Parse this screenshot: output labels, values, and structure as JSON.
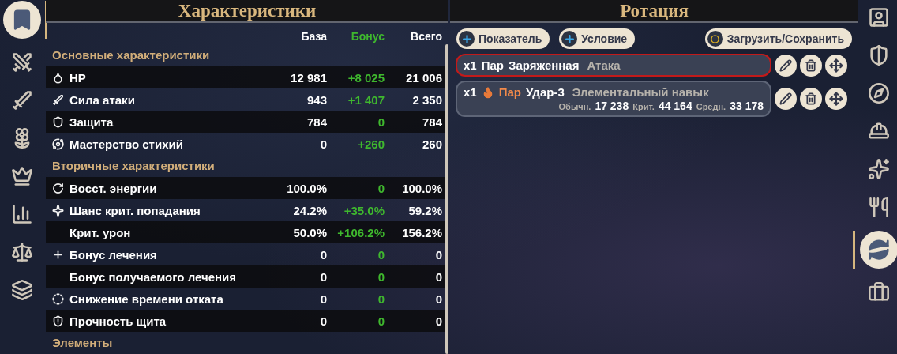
{
  "left_sidebar": [
    {
      "kind": "banner",
      "selected": true
    },
    {
      "kind": "swords",
      "selected": false
    },
    {
      "kind": "sword",
      "selected": false
    },
    {
      "kind": "flower",
      "selected": false
    },
    {
      "kind": "crown",
      "selected": false
    },
    {
      "kind": "chart",
      "selected": false
    },
    {
      "kind": "scales",
      "selected": false
    },
    {
      "kind": "cards",
      "selected": false
    }
  ],
  "stats": {
    "title": "Характеристики",
    "columns": [
      "База",
      "Бонус",
      "Всего"
    ],
    "sections": [
      {
        "title": "Основные характеристики",
        "rows": [
          {
            "kind": "hp",
            "label": "HP",
            "base": "12 981",
            "bonus": "+8 025",
            "total": "21 006"
          },
          {
            "kind": "attack",
            "label": "Сила атаки",
            "base": "943",
            "bonus": "+1 407",
            "total": "2 350"
          },
          {
            "kind": "defense",
            "label": "Защита",
            "base": "784",
            "bonus": "0",
            "total": "784"
          },
          {
            "kind": "mastery",
            "label": "Мастерство стихий",
            "base": "0",
            "bonus": "+260",
            "total": "260"
          }
        ]
      },
      {
        "title": "Вторичные характеристики",
        "rows": [
          {
            "kind": "energy",
            "label": "Восст. энергии",
            "base": "100.0%",
            "bonus": "0",
            "total": "100.0%"
          },
          {
            "kind": "crit",
            "label": "Шанс крит. попадания",
            "base": "24.2%",
            "bonus": "+35.0%",
            "total": "59.2%"
          },
          {
            "kind": "plain",
            "label": "Крит. урон",
            "base": "50.0%",
            "bonus": "+106.2%",
            "total": "156.2%"
          },
          {
            "kind": "heal",
            "label": "Бонус лечения",
            "base": "0",
            "bonus": "0",
            "total": "0"
          },
          {
            "kind": "plain",
            "label": "Бонус получаемого лечения",
            "base": "0",
            "bonus": "0",
            "total": "0"
          },
          {
            "kind": "cooldown",
            "label": "Снижение времени отката",
            "base": "0",
            "bonus": "0",
            "total": "0"
          },
          {
            "kind": "shield",
            "label": "Прочность щита",
            "base": "0",
            "bonus": "0",
            "total": "0"
          }
        ]
      },
      {
        "title": "Элементы"
      }
    ]
  },
  "rotation": {
    "title": "Ротация",
    "buttons": [
      {
        "kind": "add",
        "label": "Показатель"
      },
      {
        "kind": "add",
        "label": "Условие"
      },
      {
        "kind": "load",
        "label": "Загрузить/Сохранить"
      }
    ],
    "entries": [
      {
        "count": "x1",
        "selected": true,
        "element": false,
        "reaction": "Пар",
        "reaction_active": false,
        "name": "Заряженная",
        "type": "Атака"
      },
      {
        "count": "x1",
        "selected": false,
        "element": true,
        "reaction": "Пар",
        "reaction_active": true,
        "name": "Удар-3",
        "type": "Элементальный навык",
        "damage": [
          {
            "label": "Обычн.",
            "value": "17 238"
          },
          {
            "label": "Крит.",
            "value": "44 164"
          },
          {
            "label": "Средн.",
            "value": "33 178"
          }
        ]
      }
    ]
  },
  "right_sidebar": [
    {
      "kind": "portrait",
      "selected": false
    },
    {
      "kind": "weapon",
      "selected": false
    },
    {
      "kind": "compass",
      "selected": false
    },
    {
      "kind": "helmet",
      "selected": false
    },
    {
      "kind": "sparkles",
      "selected": false
    },
    {
      "kind": "food",
      "selected": false
    },
    {
      "kind": "rotate",
      "selected": true
    },
    {
      "kind": "bag",
      "selected": false
    }
  ]
}
